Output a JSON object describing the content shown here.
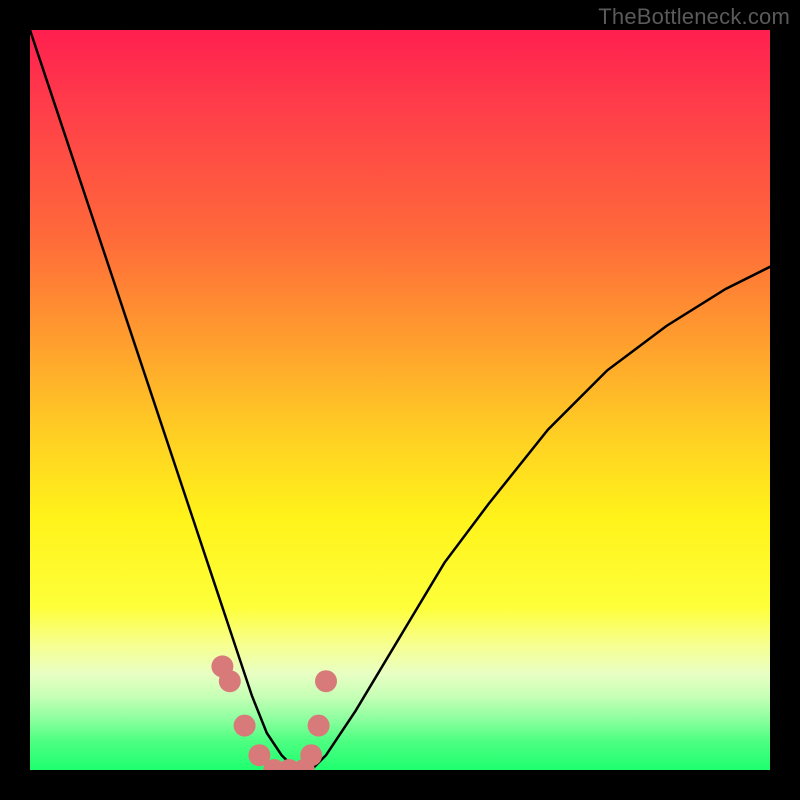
{
  "watermark": "TheBottleneck.com",
  "chart_data": {
    "type": "line",
    "title": "",
    "xlabel": "",
    "ylabel": "",
    "xlim": [
      0,
      100
    ],
    "ylim": [
      0,
      100
    ],
    "grid": false,
    "legend": false,
    "series": [
      {
        "name": "bottleneck-curve",
        "x": [
          0,
          4,
          8,
          12,
          16,
          20,
          22,
          24,
          26,
          28,
          30,
          32,
          34,
          36,
          38,
          40,
          44,
          50,
          56,
          62,
          70,
          78,
          86,
          94,
          100
        ],
        "values": [
          100,
          88,
          76,
          64,
          52,
          40,
          34,
          28,
          22,
          16,
          10,
          5,
          2,
          0,
          0,
          2,
          8,
          18,
          28,
          36,
          46,
          54,
          60,
          65,
          68
        ]
      }
    ],
    "markers": {
      "name": "highlight-points",
      "color": "#d97a7a",
      "x": [
        26,
        27,
        29,
        31,
        33,
        35,
        37,
        38,
        39,
        40
      ],
      "values": [
        14,
        12,
        6,
        2,
        0,
        0,
        0,
        2,
        6,
        12
      ]
    },
    "background": {
      "type": "vertical-gradient",
      "stops": [
        {
          "pos": 0.0,
          "color": "#ff1f4f"
        },
        {
          "pos": 0.28,
          "color": "#ff6a3a"
        },
        {
          "pos": 0.55,
          "color": "#ffd023"
        },
        {
          "pos": 0.78,
          "color": "#feff3a"
        },
        {
          "pos": 0.9,
          "color": "#c7ffb6"
        },
        {
          "pos": 1.0,
          "color": "#1eff6f"
        }
      ]
    }
  }
}
